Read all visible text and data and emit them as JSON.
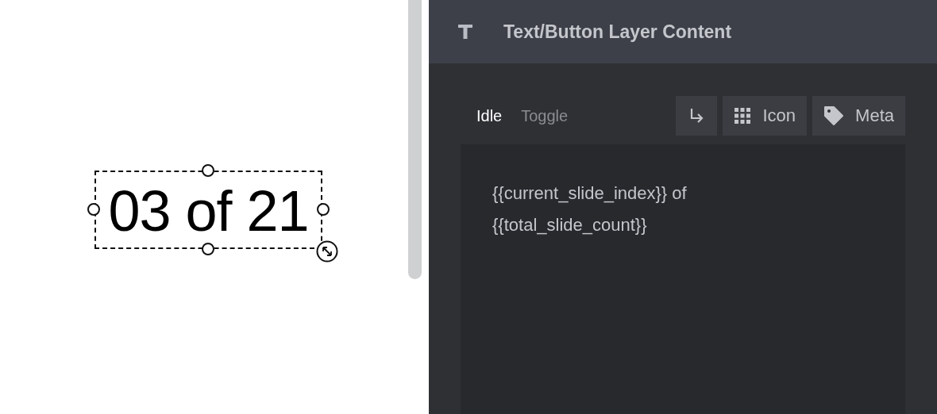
{
  "canvas": {
    "layer_text": "03 of 21",
    "selected": true
  },
  "panel": {
    "title": "Text/Button Layer Content",
    "tabs": [
      {
        "label": "Idle",
        "selected": true
      },
      {
        "label": "Toggle",
        "selected": false
      }
    ],
    "tools": [
      {
        "kind": "linebreak"
      },
      {
        "kind": "grid",
        "label": "Icon"
      },
      {
        "kind": "tag",
        "label": "Meta"
      }
    ],
    "content_lines": [
      "{{current_slide_index}} of",
      "{{total_slide_count}}"
    ]
  }
}
